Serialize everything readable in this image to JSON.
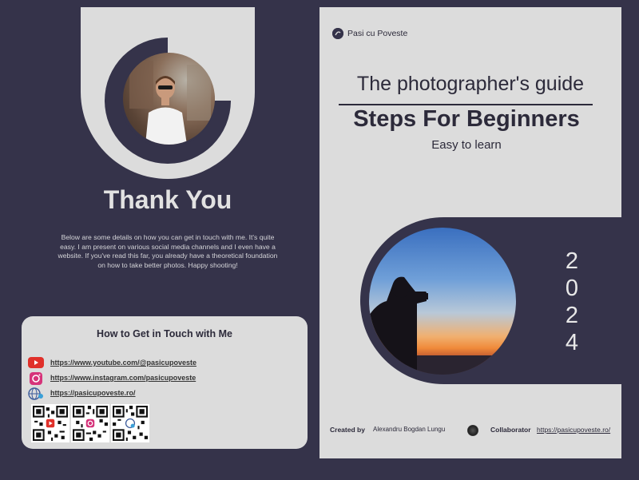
{
  "left": {
    "heading": "Thank You",
    "intro": "Below are some details on how you can get in touch with me. It's quite easy. I am present on various social media channels and I even have a website. If you've read this far, you already have a theoretical foundation on how to take better photos. Happy shooting!",
    "contact": {
      "title": "How to Get in Touch with Me",
      "links": [
        {
          "label": "https://www.youtube.com/@pasicupoveste",
          "icon": "youtube-icon"
        },
        {
          "label": "https://www.instagram.com/pasicupoveste",
          "icon": "instagram-icon"
        },
        {
          "label": "https://pasicupoveste.ro/",
          "icon": "globe-icon"
        }
      ]
    }
  },
  "right": {
    "brand": "Pasi cu Poveste",
    "title": "The photographer's guide",
    "subtitle": "Steps For Beginners",
    "tagline": "Easy to learn",
    "year_digits": [
      "2",
      "0",
      "2",
      "4"
    ],
    "footer": {
      "created_label": "Created by",
      "author": "Alexandru Bogdan Lungu",
      "collaborator_label": "Collaborator",
      "collaborator_url": "https://pasicupoveste.ro/"
    }
  },
  "colors": {
    "dark": "#35334a",
    "light": "#dcdcdc",
    "youtube": "#e0302a",
    "instagram": "#d6337a"
  }
}
